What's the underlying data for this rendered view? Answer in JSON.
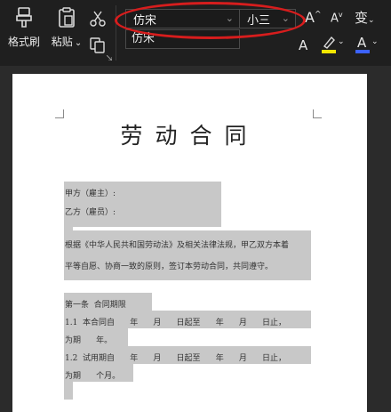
{
  "toolbar": {
    "format_painter_label": "格式刷",
    "paste_label": "粘贴",
    "paste_chevron": "⌄",
    "font_name": "仿宋",
    "font_size": "小三",
    "font_dropdown_option": "仿宋",
    "grow_font_symbol": "A",
    "shrink_font_symbol": "A",
    "phonetic_symbol": "变",
    "font_color_symbol": "A",
    "highlight_color": "#f2e600",
    "font_color": "#3c62ff",
    "annotation_color": "#d71d1d"
  },
  "document": {
    "title": "劳动合同",
    "lines": [
      "甲方（雇主）:",
      "乙方（雇员）:",
      "",
      "根据《中华人民共和国劳动法》及相关法律法规，甲乙双方本着",
      "平等自愿、协商一致的原则，签订本劳动合同，共同遵守。",
      "",
      "第一条  合同期限",
      "1.1  本合同自      年      月      日起至      年      月      日止，",
      "为期      年。",
      "1.2  试用期自      年      月      日起至      年      月      日止，",
      "为期      个月。"
    ]
  }
}
